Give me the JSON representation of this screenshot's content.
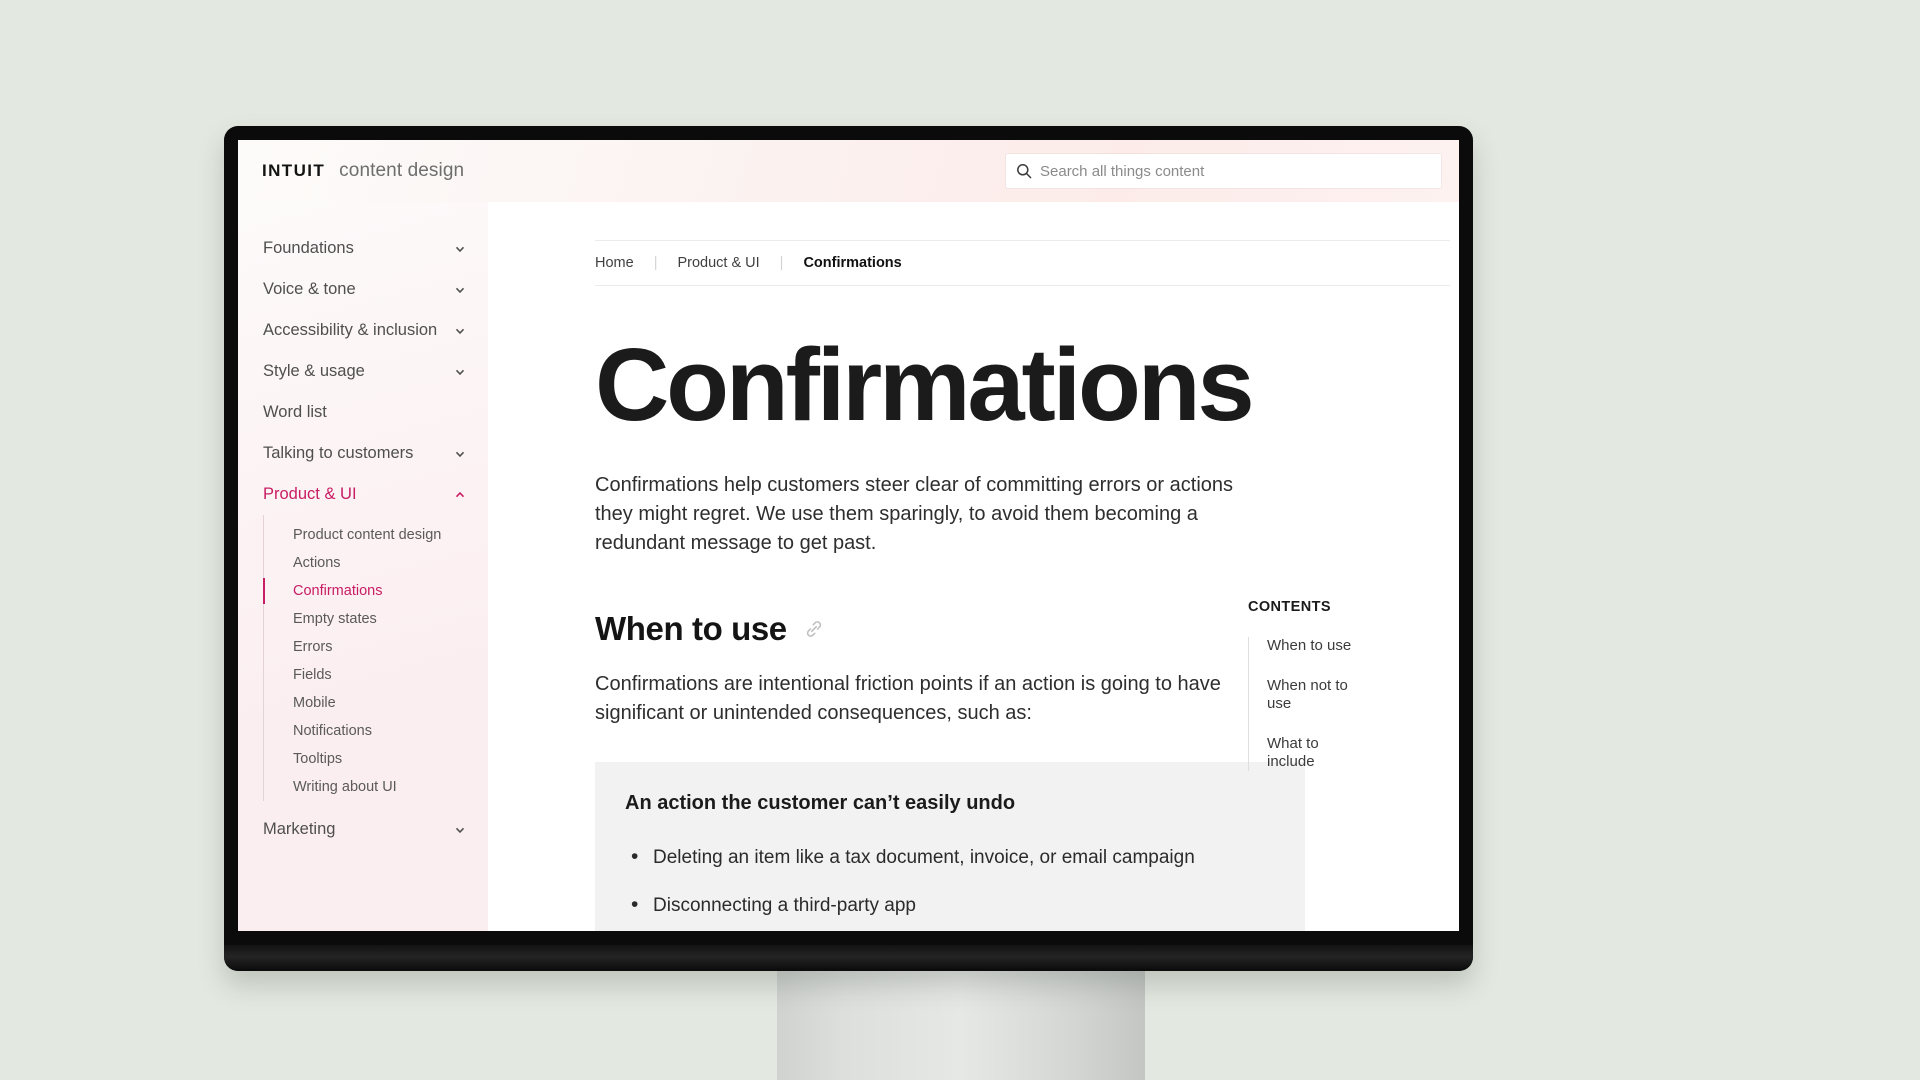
{
  "header": {
    "brand_logo": "INTUIT",
    "brand_sub": "content design",
    "search_placeholder": "Search all things content",
    "search_value": "",
    "search_icon": "search-icon"
  },
  "sidebar": {
    "items": [
      {
        "label": "Foundations",
        "expandable": true,
        "active": false
      },
      {
        "label": "Voice & tone",
        "expandable": true,
        "active": false
      },
      {
        "label": "Accessibility & inclusion",
        "expandable": true,
        "active": false
      },
      {
        "label": "Style & usage",
        "expandable": true,
        "active": false
      },
      {
        "label": "Word list",
        "expandable": false,
        "active": false
      },
      {
        "label": "Talking to customers",
        "expandable": true,
        "active": false
      },
      {
        "label": "Product & UI",
        "expandable": true,
        "active": true
      }
    ],
    "sub_items": [
      {
        "label": "Product content design",
        "active": false
      },
      {
        "label": "Actions",
        "active": false
      },
      {
        "label": "Confirmations",
        "active": true
      },
      {
        "label": "Empty states",
        "active": false
      },
      {
        "label": "Errors",
        "active": false
      },
      {
        "label": "Fields",
        "active": false
      },
      {
        "label": "Mobile",
        "active": false
      },
      {
        "label": "Notifications",
        "active": false
      },
      {
        "label": "Tooltips",
        "active": false
      },
      {
        "label": "Writing about UI",
        "active": false
      }
    ],
    "bottom_item": {
      "label": "Marketing",
      "expandable": true
    },
    "active_color": "#c81d63"
  },
  "breadcrumb": [
    {
      "label": "Home",
      "current": false
    },
    {
      "label": "Product & UI",
      "current": false
    },
    {
      "label": "Confirmations",
      "current": true
    }
  ],
  "main": {
    "title": "Confirmations",
    "lead": "Confirmations help customers steer clear of committing errors or actions they might regret. We use them sparingly, to avoid them becoming a redundant message to get past.",
    "section_heading": "When to use",
    "section_paragraph": "Confirmations are intentional friction points if an action is going to have significant or unintended consequences, such as:",
    "callout": {
      "heading": "An action the customer can’t easily undo",
      "bullets": [
        "Deleting an item like a tax document, invoice, or email campaign",
        "Disconnecting a third-party app"
      ]
    }
  },
  "toc": {
    "title": "CONTENTS",
    "items": [
      {
        "label": "When to use"
      },
      {
        "label": "When not to use"
      },
      {
        "label": "What to include"
      }
    ]
  }
}
